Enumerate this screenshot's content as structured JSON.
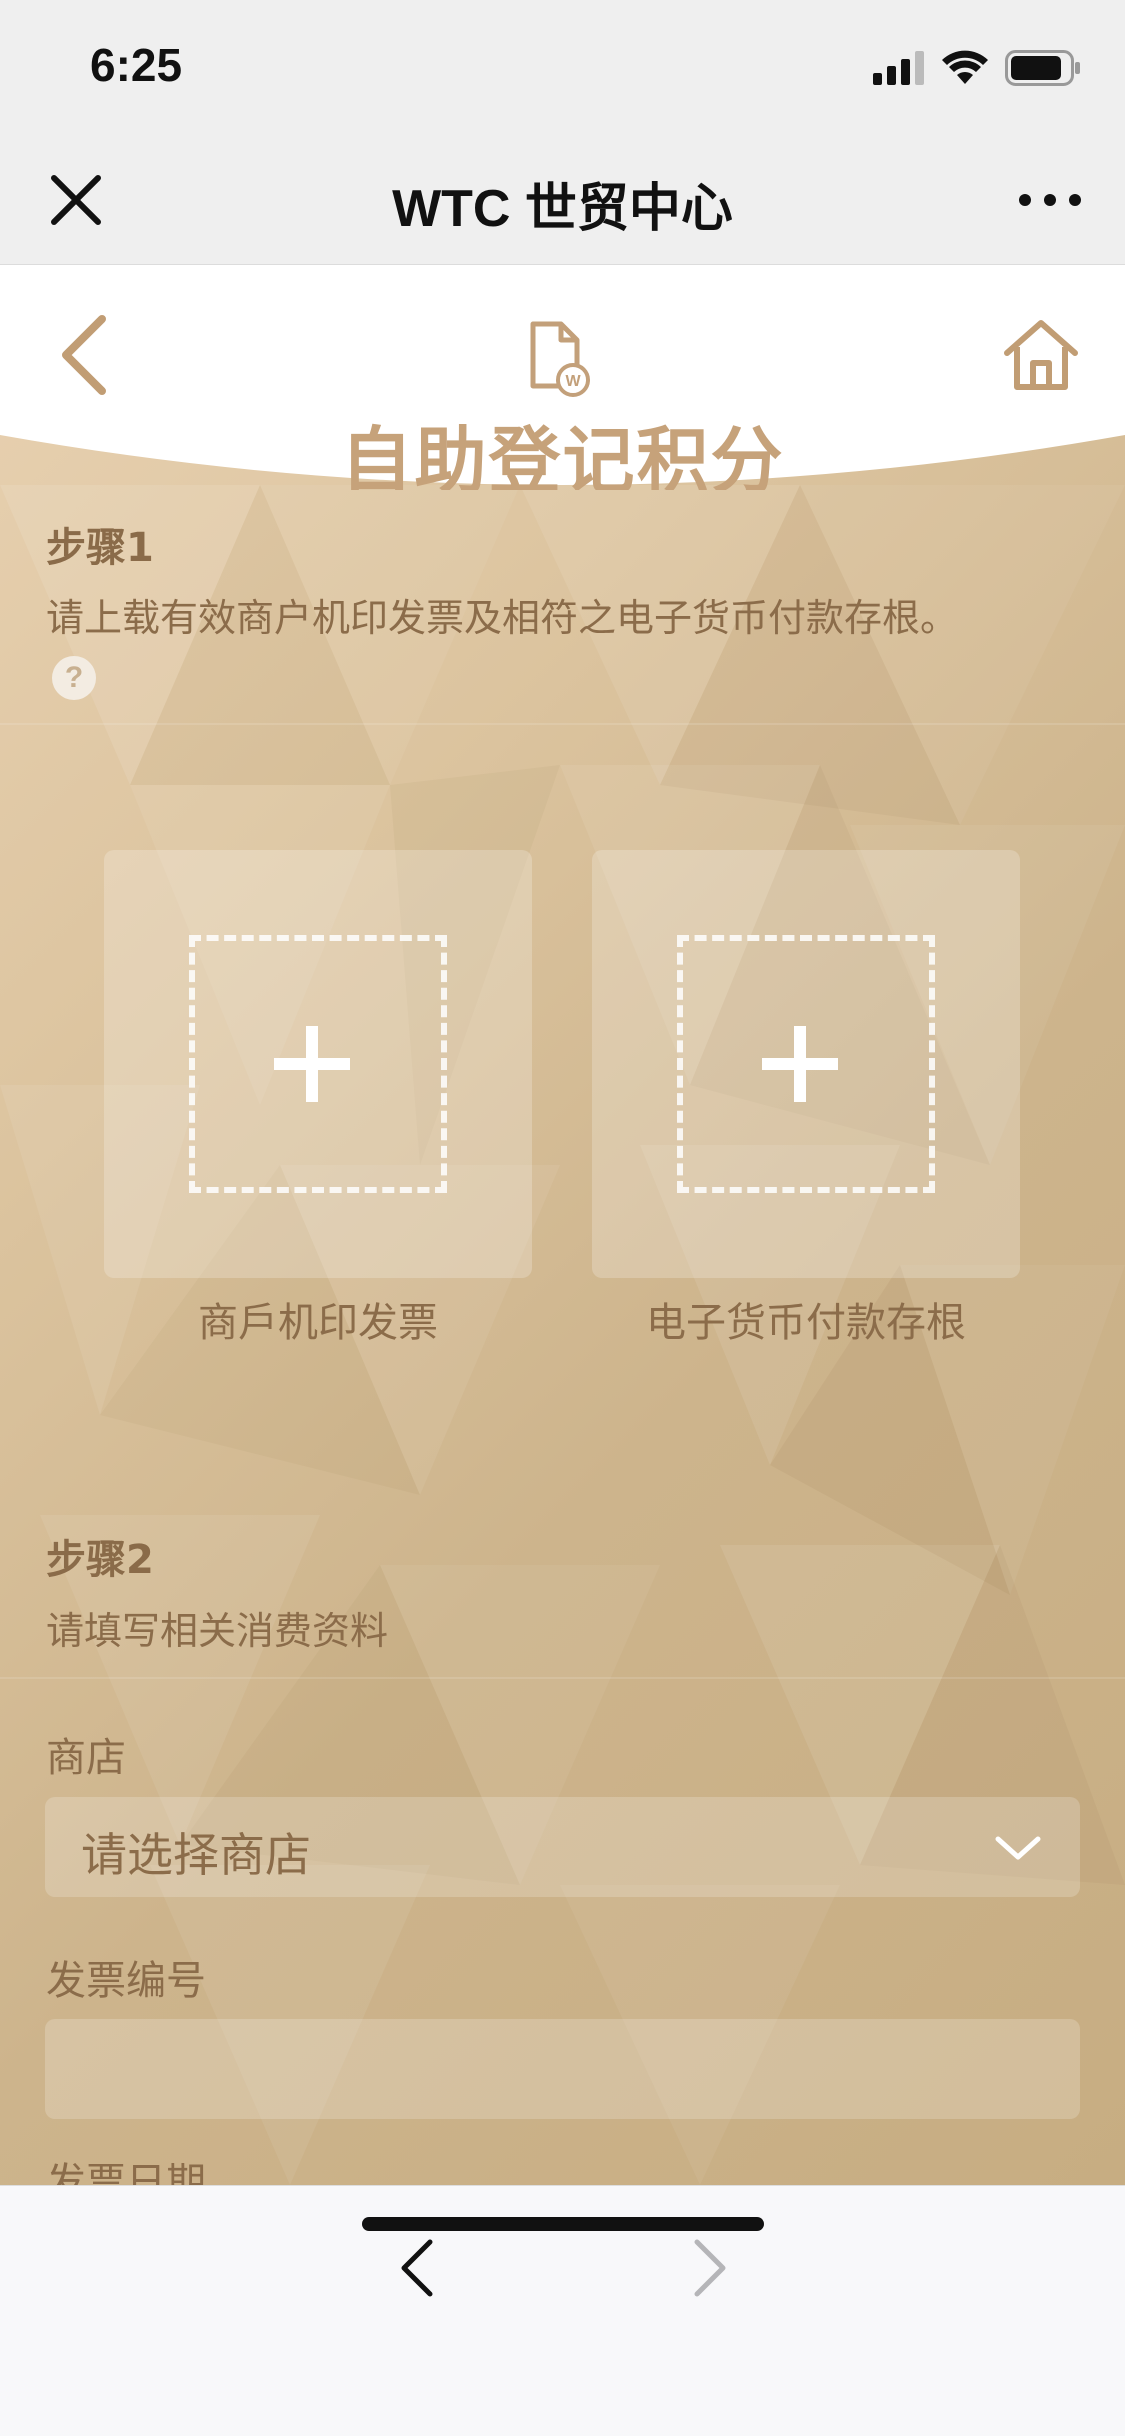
{
  "status_bar": {
    "time": "6:25"
  },
  "wechat_nav": {
    "title": "WTC 世贸中心"
  },
  "header": {
    "title": "自助登记积分"
  },
  "step1": {
    "title": "步骤1",
    "description": "请上载有效商户机印发票及相符之电子货币付款存根。",
    "help": "?",
    "uploads": [
      {
        "label": "商戶机印发票"
      },
      {
        "label": "电子货币付款存根"
      }
    ]
  },
  "step2": {
    "title": "步骤2",
    "description": "请填写相关消费资料",
    "store_label": "商店",
    "store_placeholder": "请选择商店",
    "invoice_label": "发票编号",
    "invoice_value": "",
    "date_label": "发票日期"
  },
  "colors": {
    "accent": "#c6a27a",
    "text_brown": "#8b6c4a"
  }
}
